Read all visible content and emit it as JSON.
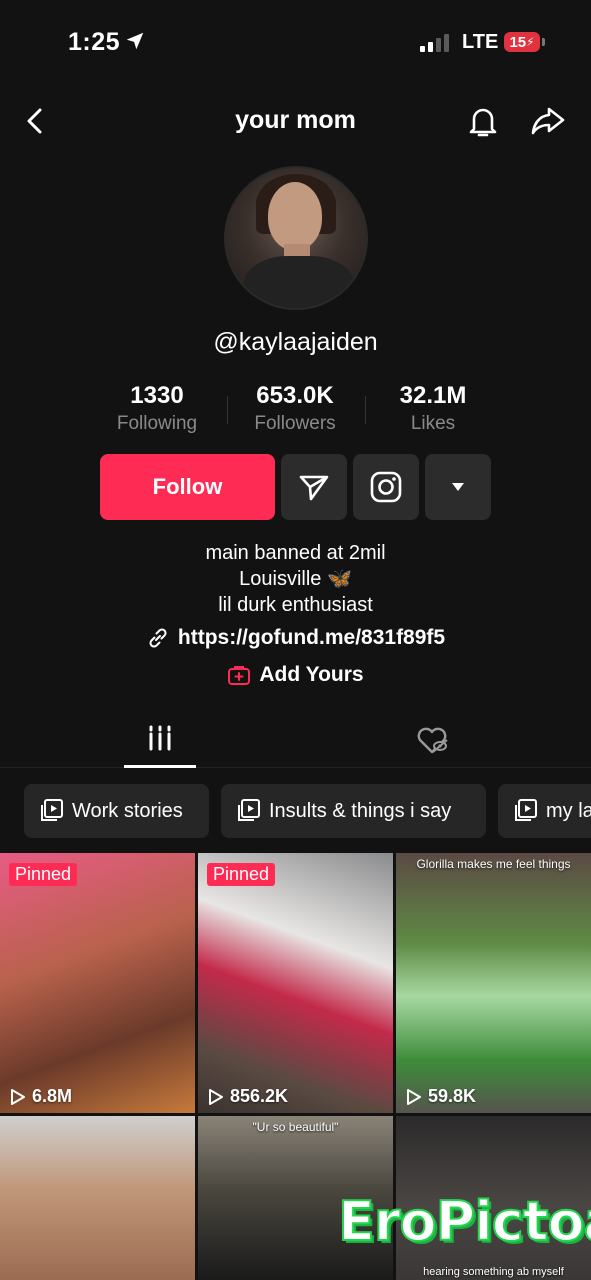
{
  "status_bar": {
    "time": "1:25",
    "network": "LTE",
    "battery": "15"
  },
  "header": {
    "title": "your mom"
  },
  "profile": {
    "username": "@kaylaajaiden",
    "stats": [
      {
        "value": "1330",
        "label": "Following"
      },
      {
        "value": "653.0K",
        "label": "Followers"
      },
      {
        "value": "32.1M",
        "label": "Likes"
      }
    ],
    "follow_label": "Follow",
    "bio_lines": [
      "main banned at 2mil",
      "Louisville 🦋",
      "lil durk enthusiast"
    ],
    "link": "https://gofund.me/831f89f5",
    "add_yours": "Add Yours"
  },
  "playlists": [
    {
      "label": "Work stories"
    },
    {
      "label": "Insults & things i say"
    },
    {
      "label": "my la"
    }
  ],
  "videos": [
    {
      "pinned": "Pinned",
      "views": "6.8M",
      "caption": ""
    },
    {
      "pinned": "Pinned",
      "views": "856.2K",
      "caption": ""
    },
    {
      "pinned": "",
      "views": "59.8K",
      "caption": "Glorilla makes me feel things"
    },
    {
      "pinned": "",
      "views": "",
      "caption": ""
    },
    {
      "pinned": "",
      "views": "",
      "caption": "\"Ur so beautiful\""
    },
    {
      "pinned": "",
      "views": "",
      "caption": "hearing something ab myself"
    }
  ],
  "watermark": "EroPictoa",
  "colors": {
    "accent": "#fe2c55",
    "background": "#121212",
    "button": "#2c2c2c",
    "muted_text": "#8a8a8a",
    "watermark_green": "#22d64d"
  }
}
